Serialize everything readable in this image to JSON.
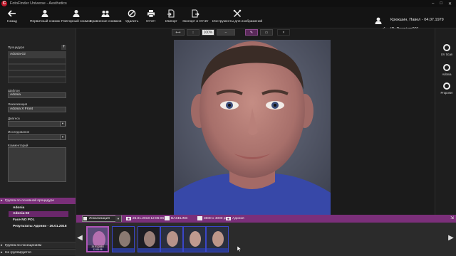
{
  "window": {
    "title": "FotoFinder Universe - Aesthetics",
    "logo_glyph": "C"
  },
  "toolbar": {
    "back": "Назад",
    "first_shot": "Первичный снимок",
    "repeat_shot": "Повторный снимок",
    "compare": "Сравнение снимков",
    "delete": "Удалить",
    "report": "Отчёт",
    "import": "Импорт",
    "export": "Экспорт и Отчёт",
    "tools": "Инструменты для изображений"
  },
  "patient": {
    "name": "Крюкшин, Павел - 04.07.1979",
    "id": "ID: Premium001",
    "gender_symbol": "♂"
  },
  "viewbar": {
    "fit_width": "⟷",
    "fit_height": "↕",
    "zoom": "100%",
    "zoom_out": "−",
    "zoom_in": "+",
    "draw": "✎",
    "overlay": "▭",
    "close": "×"
  },
  "sidebar": {
    "procedure_label": "Процедура",
    "procedures": [
      "Adonia-02",
      "",
      "",
      "",
      "",
      ""
    ],
    "template_label": "Шаблон",
    "template_value": "Adonia",
    "location_label": "Локализация",
    "location_value": "Adonia X Front",
    "diagnosis_label": "Диагноз",
    "diagnosis_value": "",
    "study_label": "Исследование",
    "study_value": "",
    "comment_label": "Комментарий",
    "group_main": "Группа по основной процедуре",
    "group_items": [
      "Adonia",
      "Adonia-02",
      "Face NO POL",
      "Результаты Адонии - 26.01.2018"
    ],
    "group_visits": "Группа по посещениям",
    "no_group": "Не группируется"
  },
  "rightpanel": {
    "items": [
      "UV Scan",
      "Adonia",
      "Proposer"
    ]
  },
  "infobar": {
    "location": "Локализация",
    "datetime": "26.01.2018 12:06:06",
    "baseline": "BASELINE",
    "resolution": "3600 x 4000 px",
    "device": "Адония"
  },
  "filmstrip": {
    "thumbnails": [
      {
        "date": "26.01.2018 12:06:06",
        "selected": true
      },
      {
        "date": "",
        "selected": false
      },
      {
        "date": "",
        "selected": false
      },
      {
        "date": "",
        "selected": false
      },
      {
        "date": "",
        "selected": false
      },
      {
        "date": "",
        "selected": false
      }
    ]
  },
  "colors": {
    "accent": "#7b2f7a",
    "thumb_border": "#3a46c8",
    "logo_red": "#c0182b"
  }
}
